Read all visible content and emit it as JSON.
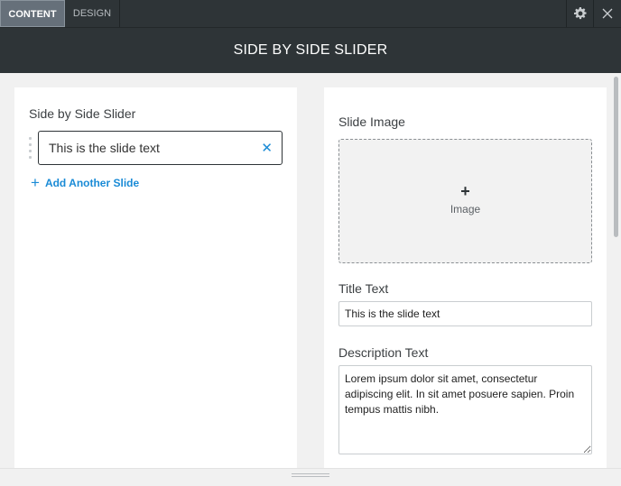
{
  "tabs": [
    {
      "label": "Content",
      "active": true
    },
    {
      "label": "Design",
      "active": false
    }
  ],
  "icons": {
    "settings": "gear-icon",
    "close": "close-icon"
  },
  "title": "SIDE BY SIDE SLIDER",
  "left": {
    "heading": "Side by Side Slider",
    "slides": [
      {
        "text": "This is the slide text"
      }
    ],
    "add_label": "Add Another Slide"
  },
  "right": {
    "slide_image_label": "Slide Image",
    "image_placeholder": "Image",
    "title_label": "Title Text",
    "title_value": "This is the slide text",
    "description_label": "Description Text",
    "description_value": "Lorem ipsum dolor sit amet, consectetur adipiscing elit. In sit amet posuere sapien. Proin tempus mattis nibh."
  },
  "colors": {
    "header_bg": "#2e3437",
    "active_tab_bg": "#66707a",
    "accent": "#1a8bd6"
  }
}
